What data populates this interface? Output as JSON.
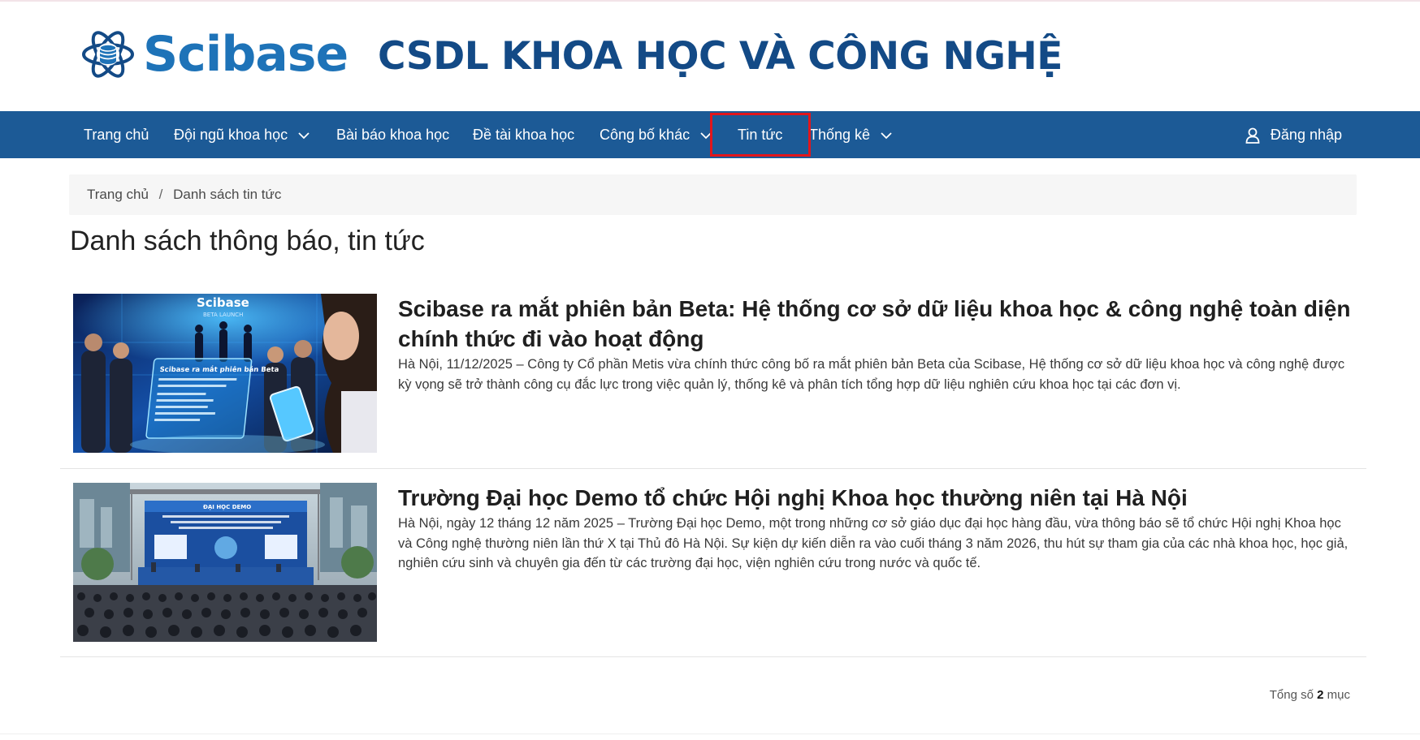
{
  "brand": {
    "logo_text": "Scibase",
    "site_title": "CSDL KHOA HỌC VÀ CÔNG NGHỆ",
    "logo_color": "#1e73b8",
    "title_color": "#134a86"
  },
  "nav": {
    "background": "#1c5a96",
    "items": [
      {
        "label": "Trang chủ",
        "has_dropdown": false
      },
      {
        "label": "Đội ngũ khoa học",
        "has_dropdown": true
      },
      {
        "label": "Bài báo khoa học",
        "has_dropdown": false
      },
      {
        "label": "Đề tài khoa học",
        "has_dropdown": false
      },
      {
        "label": "Công bố khác",
        "has_dropdown": true
      },
      {
        "label": "Tin tức",
        "has_dropdown": false,
        "highlighted": true
      },
      {
        "label": "Thống kê",
        "has_dropdown": true
      }
    ],
    "login_label": "Đăng nhập",
    "login_icon": "user-icon",
    "highlight_color": "#e2161c"
  },
  "breadcrumb": {
    "items": [
      "Trang chủ",
      "Danh sách tin tức"
    ],
    "separator": "/"
  },
  "page_title": "Danh sách thông báo, tin tức",
  "news": [
    {
      "title": "Scibase ra mắt phiên bản Beta: Hệ thống cơ sở dữ liệu khoa học & công nghệ toàn diện chính thức đi vào hoạt động",
      "description": "Hà Nội, 11/12/2025 – Công ty Cổ phần Metis vừa chính thức công bố ra mắt phiên bản Beta của Scibase, Hệ thống cơ sở dữ liệu khoa học và công nghệ được kỳ vọng sẽ trở thành công cụ đắc lực trong việc quản lý, thống kê và phân tích tổng hợp dữ liệu nghiên cứu khoa học tại các đơn vị.",
      "image": {
        "brand_text": "Scibase",
        "sub_text": "BETA LAUNCH",
        "screen_text": "Scibase ra mắt phiên bản Beta"
      }
    },
    {
      "title": "Trường Đại học Demo tổ chức Hội nghị Khoa học thường niên tại Hà Nội",
      "description": "Hà Nội, ngày 12 tháng 12 năm 2025 – Trường Đại học Demo, một trong những cơ sở giáo dục đại học hàng đầu, vừa thông báo sẽ tổ chức Hội nghị Khoa học và Công nghệ thường niên lần thứ X tại Thủ đô Hà Nội. Sự kiện dự kiến diễn ra vào cuối tháng 3 năm 2026, thu hút sự tham gia của các nhà khoa học, học giả, nghiên cứu sinh và chuyên gia đến từ các trường đại học, viện nghiên cứu trong nước và quốc tế.",
      "image": {
        "banner_text": "ĐẠI HỌC DEMO"
      }
    }
  ],
  "total": {
    "prefix": "Tổng số",
    "count": "2",
    "suffix": "mục"
  }
}
